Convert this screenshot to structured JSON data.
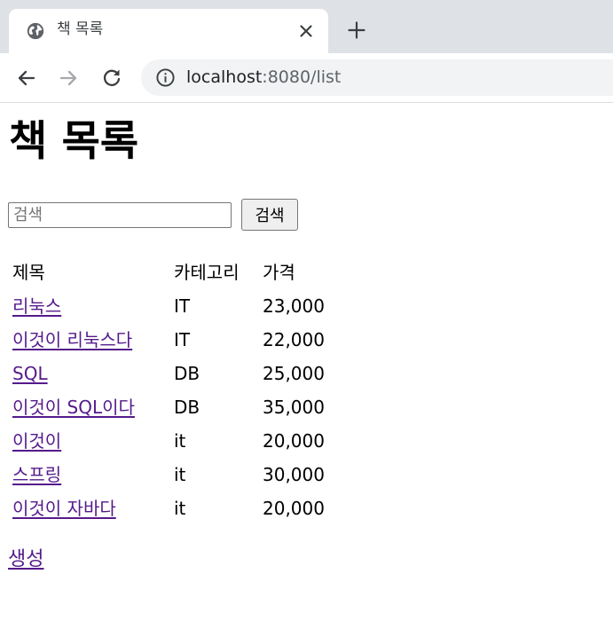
{
  "browser": {
    "tab_title": "책 목록",
    "url_host": "localhost",
    "url_rest": ":8080/list"
  },
  "page": {
    "title": "책 목록",
    "search": {
      "placeholder": "검색",
      "value": "",
      "button_label": "검색"
    },
    "table": {
      "headers": [
        "제목",
        "카테고리",
        "가격"
      ],
      "rows": [
        {
          "title": "리눅스",
          "category": "IT",
          "price": "23,000"
        },
        {
          "title": "이것이 리눅스다",
          "category": "IT",
          "price": "22,000"
        },
        {
          "title": "SQL",
          "category": "DB",
          "price": "25,000"
        },
        {
          "title": "이것이 SQL이다",
          "category": "DB",
          "price": "35,000"
        },
        {
          "title": "이것이",
          "category": "it",
          "price": "20,000"
        },
        {
          "title": "스프링",
          "category": "it",
          "price": "30,000"
        },
        {
          "title": "이것이 자바다",
          "category": "it",
          "price": "20,000"
        }
      ]
    },
    "create_link": "생성"
  },
  "icons": {
    "favicon": "globe-icon",
    "tab_close": "close-icon",
    "new_tab": "plus-icon",
    "back": "back-arrow-icon",
    "forward": "forward-arrow-icon",
    "reload": "reload-icon",
    "site_info": "info-icon"
  },
  "colors": {
    "tabstrip": "#dee1e6",
    "omnibox": "#f1f3f4",
    "visited_link": "#551a8b"
  }
}
